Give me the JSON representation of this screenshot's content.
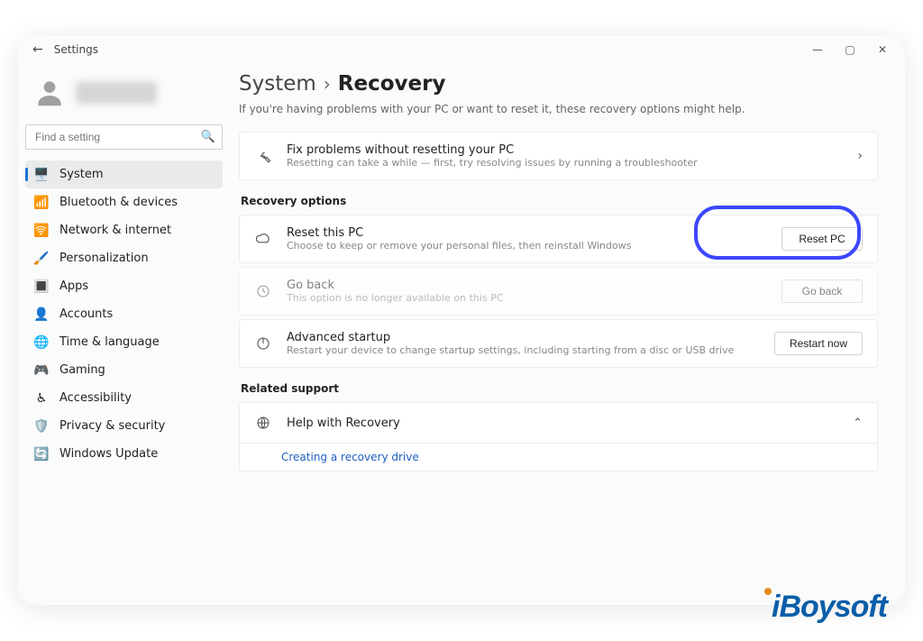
{
  "titlebar": {
    "back": "←",
    "title": "Settings"
  },
  "search": {
    "placeholder": "Find a setting"
  },
  "sidebar": {
    "items": [
      {
        "icon": "🖥️",
        "label": "System",
        "active": true
      },
      {
        "icon": "📶",
        "label": "Bluetooth & devices"
      },
      {
        "icon": "🛜",
        "label": "Network & internet"
      },
      {
        "icon": "🖌️",
        "label": "Personalization"
      },
      {
        "icon": "🔳",
        "label": "Apps"
      },
      {
        "icon": "👤",
        "label": "Accounts"
      },
      {
        "icon": "🌐",
        "label": "Time & language"
      },
      {
        "icon": "🎮",
        "label": "Gaming"
      },
      {
        "icon": "♿",
        "label": "Accessibility"
      },
      {
        "icon": "🛡️",
        "label": "Privacy & security"
      },
      {
        "icon": "🔄",
        "label": "Windows Update"
      }
    ]
  },
  "breadcrumb": {
    "parent": "System",
    "current": "Recovery"
  },
  "page_desc": "If you're having problems with your PC or want to reset it, these recovery options might help.",
  "fix_card": {
    "title": "Fix problems without resetting your PC",
    "sub": "Resetting can take a while — first, try resolving issues by running a troubleshooter"
  },
  "section_recovery": "Recovery options",
  "reset_card": {
    "title": "Reset this PC",
    "sub": "Choose to keep or remove your personal files, then reinstall Windows",
    "button": "Reset PC"
  },
  "goback_card": {
    "title": "Go back",
    "sub": "This option is no longer available on this PC",
    "button": "Go back"
  },
  "advanced_card": {
    "title": "Advanced startup",
    "sub": "Restart your device to change startup settings, including starting from a disc or USB drive",
    "button": "Restart now"
  },
  "section_related": "Related support",
  "help_card": {
    "title": "Help with Recovery"
  },
  "help_link": "Creating a recovery drive",
  "watermark": "iBoysoft"
}
